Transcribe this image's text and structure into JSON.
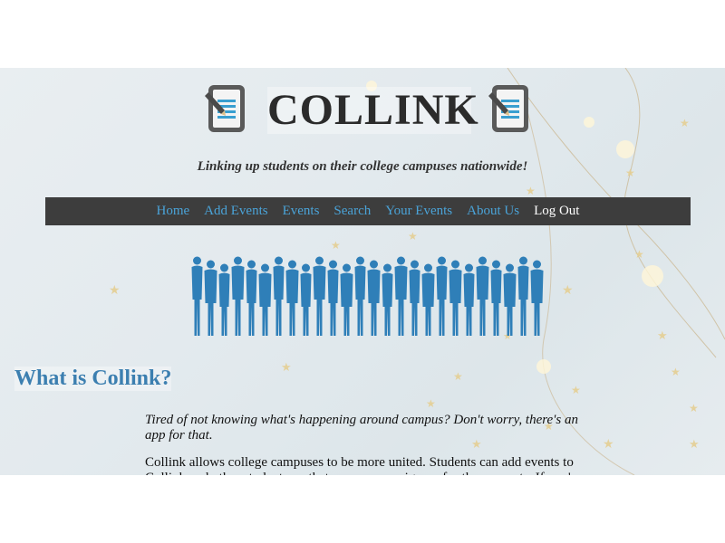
{
  "site": {
    "title": "COLLINK",
    "tagline": "Linking up students on their college campuses nationwide!"
  },
  "nav": {
    "items": [
      {
        "label": "Home"
      },
      {
        "label": "Add Events"
      },
      {
        "label": "Events"
      },
      {
        "label": "Search"
      },
      {
        "label": "Your Events"
      },
      {
        "label": "About Us"
      },
      {
        "label": "Log Out"
      }
    ]
  },
  "colors": {
    "accent": "#4aa3d8",
    "nav_bg": "#3d3d3d",
    "heading": "#3c7fb0",
    "crowd": "#2f7fb8"
  },
  "icons": {
    "logo_left": "document-pencil-icon",
    "logo_right": "document-pencil-icon",
    "hero": "crowd-silhouettes-image"
  },
  "about": {
    "heading": "What is Collink?",
    "intro": "Tired of not knowing what's happening around campus? Don't worry, there's an app for that.",
    "body": "Collink allows college campuses to be more united. Students can add events to Collink and other students on that campus can sign up for those events. If you're worried about"
  }
}
